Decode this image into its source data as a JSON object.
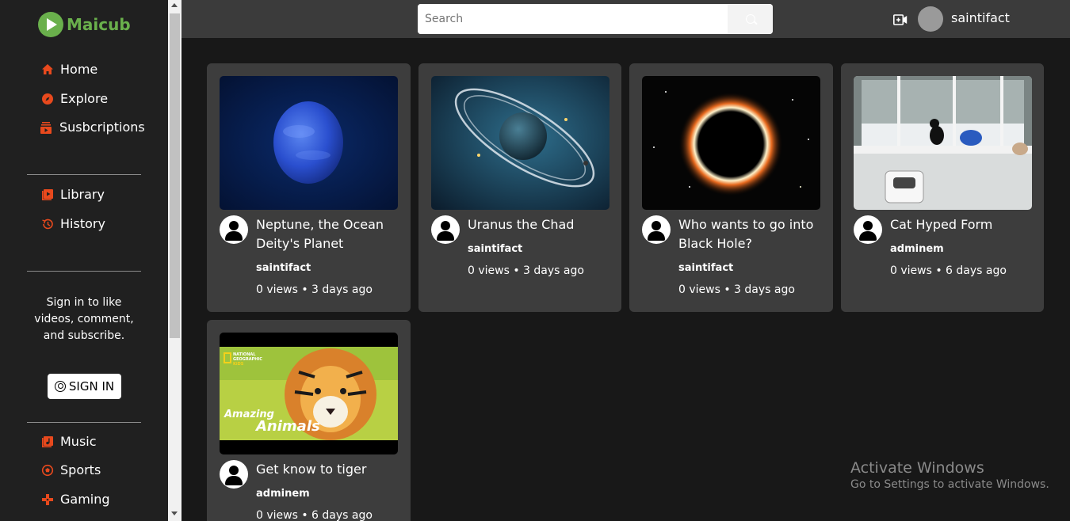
{
  "brand": {
    "name": "Maicub",
    "logo_color": "#6ab04c"
  },
  "accent_color": "#e8491d",
  "sidebar": {
    "primary": [
      {
        "label": "Home",
        "icon": "home-icon"
      },
      {
        "label": "Explore",
        "icon": "compass-icon"
      },
      {
        "label": "Susbcriptions",
        "icon": "subscriptions-icon"
      }
    ],
    "secondary": [
      {
        "label": "Library",
        "icon": "library-icon"
      },
      {
        "label": "History",
        "icon": "history-icon"
      }
    ],
    "signin_prompt": "Sign in to like videos, comment, and subscribe.",
    "signin_button": "SIGN IN",
    "categories": [
      {
        "label": "Music",
        "icon": "music-icon"
      },
      {
        "label": "Sports",
        "icon": "sports-icon"
      },
      {
        "label": "Gaming",
        "icon": "gaming-icon"
      }
    ]
  },
  "header": {
    "search_placeholder": "Search",
    "search_value": "",
    "username": "saintifact",
    "upload_icon": "video-camera-icon"
  },
  "videos": [
    {
      "title": "Neptune, the Ocean Deity's Planet",
      "channel": "saintifact",
      "meta": "0 views • 3 days ago",
      "thumb": "neptune"
    },
    {
      "title": "Uranus the Chad",
      "channel": "saintifact",
      "meta": "0 views • 3 days ago",
      "thumb": "uranus"
    },
    {
      "title": "Who wants to go into Black Hole?",
      "channel": "saintifact",
      "meta": "0 views • 3 days ago",
      "thumb": "blackhole"
    },
    {
      "title": "Cat Hyped Form",
      "channel": "adminem",
      "meta": "0 views • 6 days ago",
      "thumb": "cat"
    },
    {
      "title": "Get know to tiger",
      "channel": "adminem",
      "meta": "0 views • 6 days ago",
      "thumb": "tiger",
      "thumb_text": {
        "brand_line1": "NATIONAL",
        "brand_line2": "GEOGRAPHIC",
        "brand_line3": "KiDS",
        "caption1": "Amazing",
        "caption2": "Animals"
      }
    }
  ],
  "watermark": {
    "line1": "Activate Windows",
    "line2": "Go to Settings to activate Windows."
  }
}
